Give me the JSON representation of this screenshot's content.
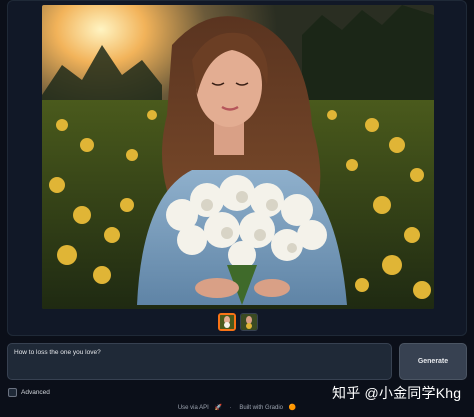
{
  "gallery": {
    "selected_index": 0,
    "thumbnail_count": 2
  },
  "prompt": {
    "value": "How to loss the one you love?"
  },
  "generate_button": {
    "label": "Generate"
  },
  "advanced": {
    "label": "Advanced"
  },
  "footer": {
    "api_text": "Use via API",
    "api_icon": "🚀",
    "separator": "·",
    "gradio_text": "Built with Gradio",
    "gradio_icon": "🟠"
  },
  "watermark": {
    "text": "知乎 @小金同学Khg"
  },
  "colors": {
    "background": "#0b0f19",
    "panel": "#111827",
    "accent": "#f97316"
  }
}
